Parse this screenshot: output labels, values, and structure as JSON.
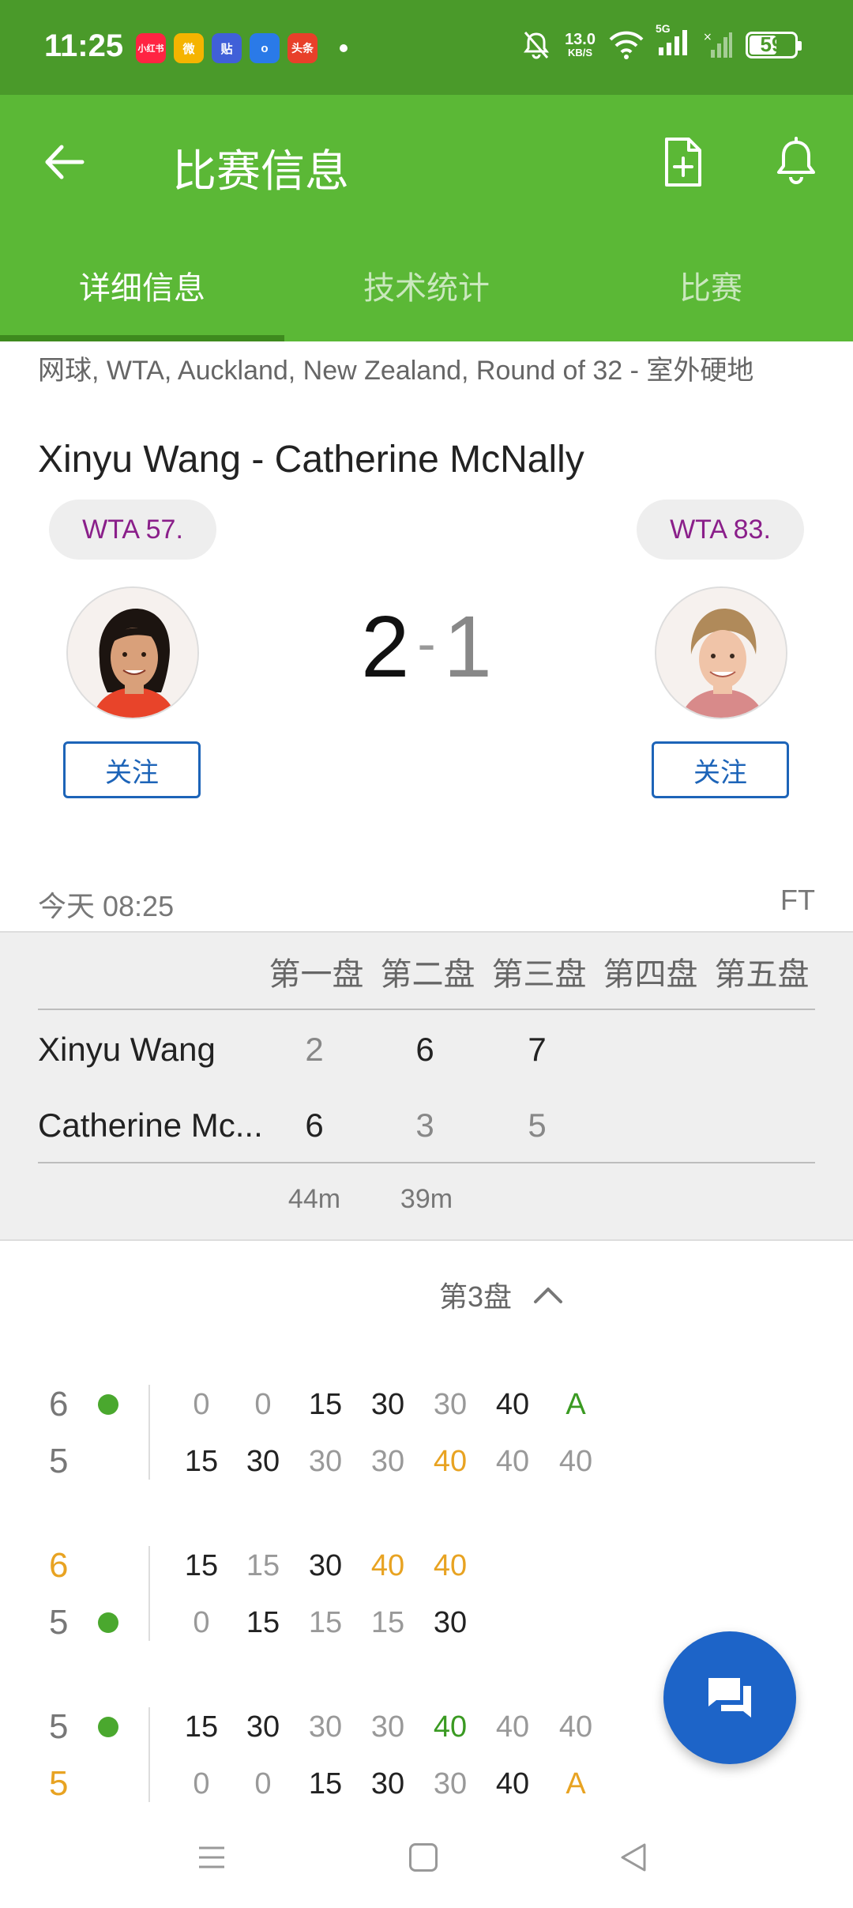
{
  "status_bar": {
    "time": "11:25",
    "apps": [
      {
        "label": "小红书",
        "color": "#ff2442"
      },
      {
        "label": "微",
        "color": "#f5b400"
      },
      {
        "label": "贴",
        "color": "#4060d8"
      },
      {
        "label": "o",
        "color": "#2a7ae8"
      },
      {
        "label": "头条",
        "color": "#e8402a"
      }
    ],
    "net_speed": "13.0",
    "net_unit": "KB/S",
    "signal_label": "5G",
    "battery": "59"
  },
  "app_bar": {
    "title": "比赛信息",
    "icons": [
      "back-arrow-icon",
      "add-document-icon",
      "bell-icon"
    ]
  },
  "tabs": [
    {
      "label": "详细信息",
      "active": true
    },
    {
      "label": "技术统计",
      "active": false
    },
    {
      "label": "比赛",
      "active": false
    }
  ],
  "match": {
    "league": "网球, WTA, Auckland, New Zealand, Round of 32 - 室外硬地",
    "title": "Xinyu Wang - Catherine McNally",
    "player1": {
      "rank": "WTA 57.",
      "follow": "关注"
    },
    "player2": {
      "rank": "WTA 83.",
      "follow": "关注"
    },
    "score_home": "2",
    "score_sep": "-",
    "score_away": "1",
    "date": "今天 08:25",
    "status": "FT"
  },
  "sets_table": {
    "headers": [
      "第一盘",
      "第二盘",
      "第三盘",
      "第四盘",
      "第五盘"
    ],
    "rows": [
      {
        "name": "Xinyu Wang",
        "sets": [
          "2",
          "6",
          "7"
        ]
      },
      {
        "name": "Catherine Mc...",
        "sets": [
          "6",
          "3",
          "5"
        ]
      }
    ],
    "durations": [
      "44m",
      "39m"
    ]
  },
  "set_detail": {
    "label": "第3盘",
    "games": [
      {
        "top": {
          "games": "6",
          "serve": true,
          "highlight": false
        },
        "bottom": {
          "games": "5",
          "serve": false,
          "highlight": false
        },
        "points_top": [
          "0",
          "0",
          "15",
          "30",
          "30",
          "40",
          "A"
        ],
        "points_bottom": [
          "15",
          "30",
          "30",
          "30",
          "40",
          "40",
          "40"
        ]
      },
      {
        "top": {
          "games": "6",
          "serve": false,
          "highlight": true
        },
        "bottom": {
          "games": "5",
          "serve": true,
          "highlight": false
        },
        "points_top": [
          "15",
          "15",
          "30",
          "40",
          "40"
        ],
        "points_bottom": [
          "0",
          "15",
          "15",
          "15",
          "30"
        ]
      },
      {
        "top": {
          "games": "5",
          "serve": true,
          "highlight": false
        },
        "bottom": {
          "games": "5",
          "serve": false,
          "highlight": true
        },
        "points_top": [
          "15",
          "30",
          "30",
          "30",
          "40",
          "40",
          "40"
        ],
        "points_bottom": [
          "0",
          "0",
          "15",
          "30",
          "30",
          "40",
          "A"
        ]
      }
    ]
  },
  "fab_icon": "chat-icon",
  "nav_icons": [
    "menu-icon",
    "home-icon",
    "back-icon"
  ]
}
